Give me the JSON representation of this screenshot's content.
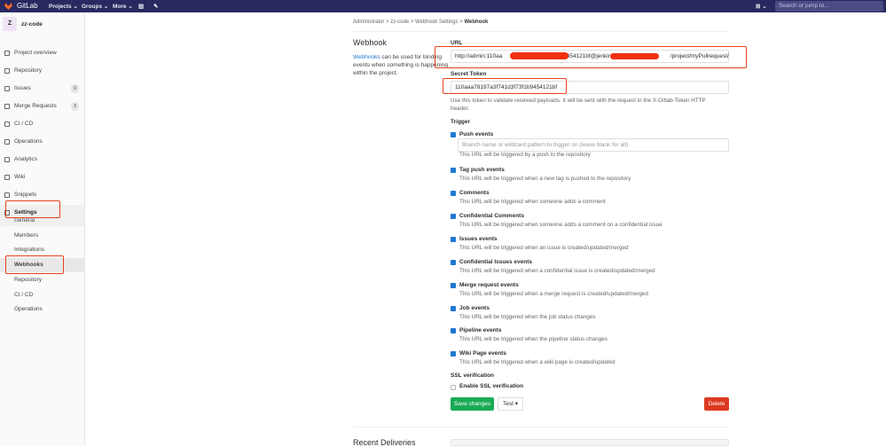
{
  "nav": {
    "brand": "GitLab",
    "projects": "Projects ⌄",
    "groups": "Groups ⌄",
    "more": "More ⌄",
    "plus": "⊞ ⌄",
    "search_placeholder": "Search or jump to..."
  },
  "sidebar": {
    "avatar": "Z",
    "project": "zz-code",
    "items": [
      {
        "label": "Project overview"
      },
      {
        "label": "Repository"
      },
      {
        "label": "Issues",
        "badge": "0"
      },
      {
        "label": "Merge Requests",
        "badge": "3"
      },
      {
        "label": "CI / CD"
      },
      {
        "label": "Operations"
      },
      {
        "label": "Analytics"
      },
      {
        "label": "Wiki"
      },
      {
        "label": "Snippets"
      },
      {
        "label": "Settings"
      }
    ],
    "subitems": [
      "General",
      "Members",
      "Integrations",
      "Webhooks",
      "Repository",
      "CI / CD",
      "Operations"
    ]
  },
  "breadcrumb": [
    "Administrator",
    "zz-code",
    "Webhook Settings",
    "Webhook"
  ],
  "left": {
    "title": "Webhook",
    "link": "Webhooks",
    "desc": " can be used for binding events when something is happening within the project."
  },
  "form": {
    "url_label": "URL",
    "url_value": "http://admin:110aa                                 f1b9454121bf@jenkins                                   /project/myPullrequest/",
    "token_label": "Secret Token",
    "token_value": "110aaa78197a3f741d3f73f1b9454121bf",
    "token_help": "Use this token to validate received payloads. It will be sent with the request in the X-Gitlab-Token HTTP header.",
    "trigger_label": "Trigger",
    "branch_placeholder": "Branch name or wildcard pattern to trigger on (leave blank for all)",
    "events": [
      {
        "title": "Push events",
        "desc": "This URL will be triggered by a push to the repository",
        "checked": true
      },
      {
        "title": "Tag push events",
        "desc": "This URL will be triggered when a new tag is pushed to the repository",
        "checked": true
      },
      {
        "title": "Comments",
        "desc": "This URL will be triggered when someone adds a comment",
        "checked": true
      },
      {
        "title": "Confidential Comments",
        "desc": "This URL will be triggered when someone adds a comment on a confidential issue",
        "checked": true
      },
      {
        "title": "Issues events",
        "desc": "This URL will be triggered when an issue is created/updated/merged",
        "checked": true
      },
      {
        "title": "Confidential Issues events",
        "desc": "This URL will be triggered when a confidential issue is created/updated/merged",
        "checked": true
      },
      {
        "title": "Merge request events",
        "desc": "This URL will be triggered when a merge request is created/updated/merged",
        "checked": true
      },
      {
        "title": "Job events",
        "desc": "This URL will be triggered when the job status changes",
        "checked": true
      },
      {
        "title": "Pipeline events",
        "desc": "This URL will be triggered when the pipeline status changes",
        "checked": true
      },
      {
        "title": "Wiki Page events",
        "desc": "This URL will be triggered when a wiki page is created/updated",
        "checked": true
      }
    ],
    "ssl_label": "SSL verification",
    "ssl_option": "Enable SSL verification",
    "save": "Save changes",
    "test": "Test ▾",
    "delete": "Delete"
  },
  "recent": "Recent Deliveries"
}
